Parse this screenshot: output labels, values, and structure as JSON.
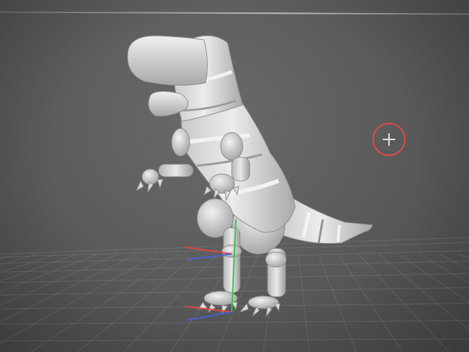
{
  "viewport": {
    "colors": {
      "background": "#5e5e5e",
      "grid_line": "#7d7d7d",
      "model_light": "#e6e6e6",
      "model_mid": "#bcbcbc",
      "model_shadow": "#8f8f8f",
      "axis_x": "#e0453a",
      "axis_y": "#3ec14a",
      "axis_z": "#4b5fd6",
      "cursor_ring": "#e24a43"
    },
    "model": {
      "icon": "dinosaur-model"
    },
    "cursor": {
      "icon": "3d-cursor-icon"
    }
  }
}
